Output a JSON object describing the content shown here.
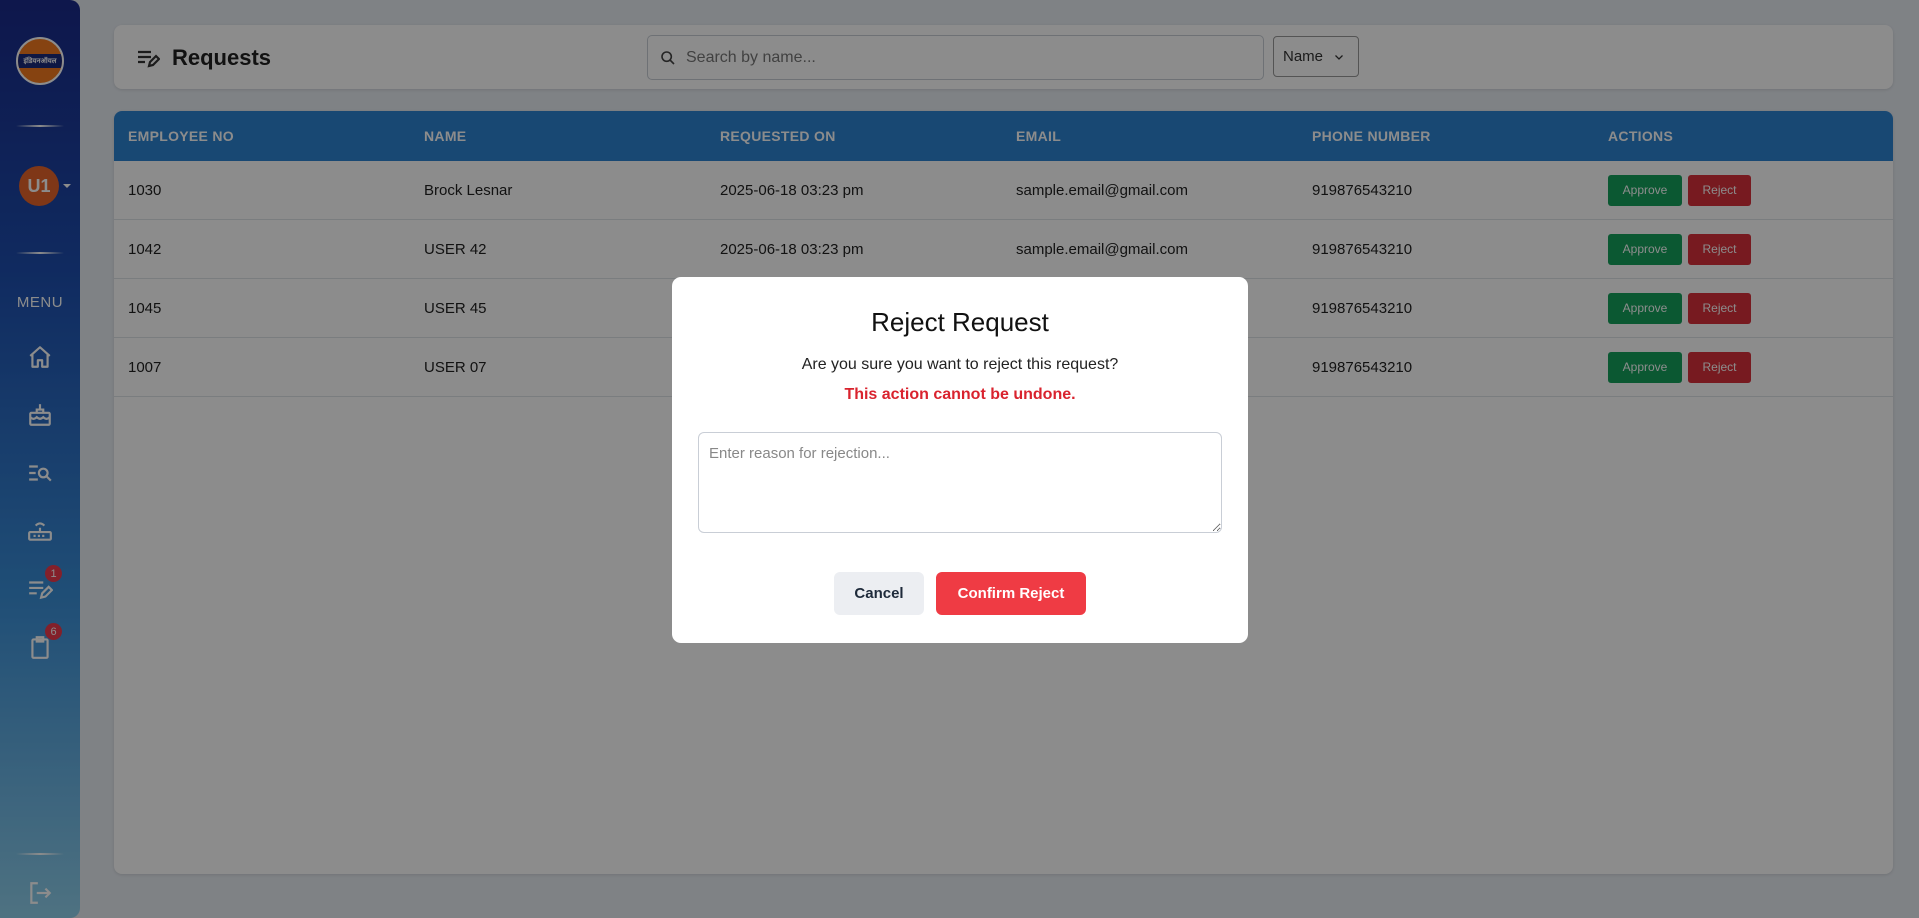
{
  "sidebar": {
    "logo_text": "इंडियनऑयल",
    "avatar_initials": "U1",
    "menu_label": "MENU",
    "nav": [
      {
        "icon": "home-icon"
      },
      {
        "icon": "cake-icon"
      },
      {
        "icon": "list-search-icon"
      },
      {
        "icon": "router-icon"
      },
      {
        "icon": "edit-list-icon",
        "badge": "1"
      },
      {
        "icon": "clipboard-icon",
        "badge": "6"
      }
    ],
    "logout_icon": "logout-icon"
  },
  "header": {
    "title": "Requests",
    "search_placeholder": "Search by name...",
    "filter_selected": "Name"
  },
  "table": {
    "columns": [
      "EMPLOYEE NO",
      "NAME",
      "REQUESTED ON",
      "EMAIL",
      "PHONE NUMBER",
      "ACTIONS"
    ],
    "rows": [
      {
        "emp": "1030",
        "name": "Brock Lesnar",
        "requested": "2025-06-18 03:23 pm",
        "email": "sample.email@gmail.com",
        "phone": "919876543210"
      },
      {
        "emp": "1042",
        "name": "USER 42",
        "requested": "2025-06-18 03:23 pm",
        "email": "sample.email@gmail.com",
        "phone": "919876543210"
      },
      {
        "emp": "1045",
        "name": "USER 45",
        "requested": "",
        "email": "",
        "phone": "919876543210"
      },
      {
        "emp": "1007",
        "name": "USER 07",
        "requested": "",
        "email": "",
        "phone": "919876543210"
      }
    ],
    "approve_label": "Approve",
    "reject_label": "Reject"
  },
  "modal": {
    "title": "Reject Request",
    "message": "Are you sure you want to reject this request?",
    "warning": "This action cannot be undone.",
    "reason_placeholder": "Enter reason for rejection...",
    "cancel_label": "Cancel",
    "confirm_label": "Confirm Reject"
  },
  "colors": {
    "table_header": "#2d84d2",
    "approve": "#15a15c",
    "reject": "#d9313b",
    "confirm": "#ef3b44",
    "warning_text": "#d9232e"
  }
}
